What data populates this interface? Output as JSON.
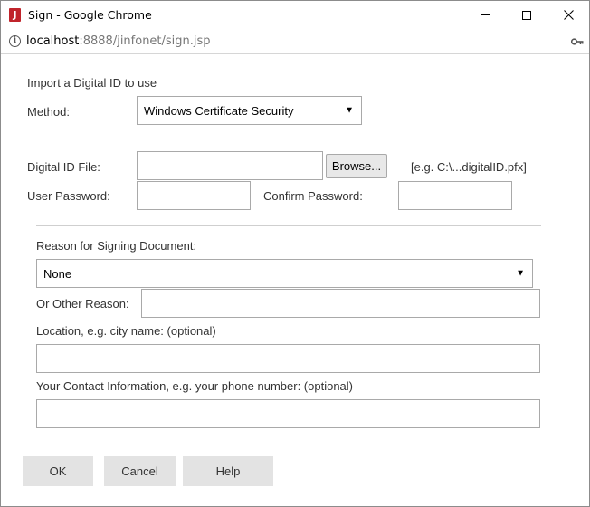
{
  "window": {
    "title": "Sign - Google Chrome",
    "app_icon_letter": "J"
  },
  "urlbar": {
    "host": "localhost",
    "rest": ":8888/jinfonet/sign.jsp"
  },
  "form": {
    "section_heading": "Import a Digital ID to use",
    "method_label": "Method:",
    "method_value": "Windows Certificate Security",
    "digital_id_file_label": "Digital ID File:",
    "browse_label": "Browse...",
    "file_example": "[e.g. C:\\...digitalID.pfx]",
    "user_password_label": "User Password:",
    "confirm_password_label": "Confirm Password:",
    "reason_label": "Reason for Signing Document:",
    "reason_value": "None",
    "other_reason_label": "Or Other Reason:",
    "location_label": "Location, e.g. city name: (optional)",
    "contact_label": "Your Contact Information, e.g. your phone number: (optional)"
  },
  "buttons": {
    "ok": "OK",
    "cancel": "Cancel",
    "help": "Help"
  },
  "icons": {
    "app": "jinfonet-app-icon",
    "info": "info-icon",
    "key": "key-icon",
    "dropdown": "caret-down-icon"
  },
  "colors": {
    "app_icon": "#c0242b",
    "button_bg": "#e3e3e3"
  }
}
